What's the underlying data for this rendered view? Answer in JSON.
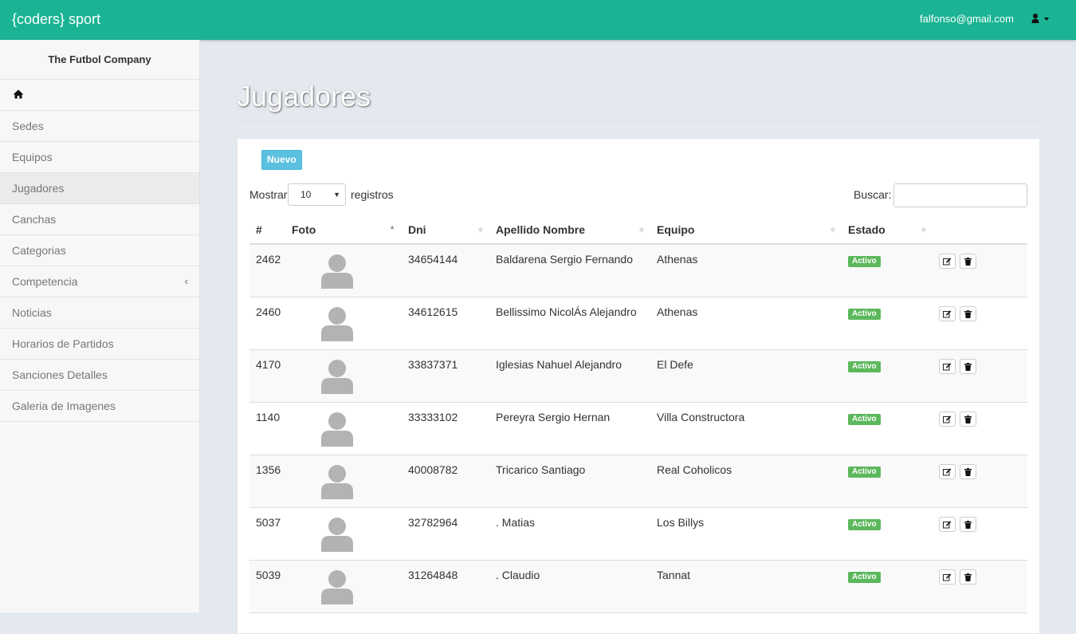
{
  "header": {
    "brand": "{coders} sport",
    "user_email": "falfonso@gmail.com",
    "user_icon": "user-icon"
  },
  "sidebar": {
    "company": "The Futbol Company",
    "items": [
      {
        "label": "",
        "icon": "home-icon"
      },
      {
        "label": "Sedes"
      },
      {
        "label": "Equipos"
      },
      {
        "label": "Jugadores"
      },
      {
        "label": "Canchas"
      },
      {
        "label": "Categorias"
      },
      {
        "label": "Competencia",
        "icon": "chevron-left-icon"
      },
      {
        "label": "Noticias"
      },
      {
        "label": "Horarios de Partidos"
      },
      {
        "label": "Sanciones Detalles"
      },
      {
        "label": "Galeria de Imagenes"
      }
    ]
  },
  "main": {
    "title": "Jugadores",
    "new_button": "Nuevo",
    "length": {
      "prefix": "Mostrar",
      "value": "10",
      "suffix": "registros"
    },
    "search": {
      "label": "Buscar:",
      "value": ""
    },
    "columns": [
      "#",
      "Foto",
      "Dni",
      "Apellido Nombre",
      "Equipo",
      "Estado",
      ""
    ],
    "rows": [
      {
        "id": "2462",
        "dni": "34654144",
        "name": "Baldarena Sergio Fernando",
        "team": "Athenas",
        "status": "Activo"
      },
      {
        "id": "2460",
        "dni": "34612615",
        "name": "Bellissimo NicolÁs Alejandro",
        "team": "Athenas",
        "status": "Activo"
      },
      {
        "id": "4170",
        "dni": "33837371",
        "name": "Iglesias Nahuel Alejandro",
        "team": "El Defe",
        "status": "Activo"
      },
      {
        "id": "1140",
        "dni": "33333102",
        "name": "Pereyra Sergio Hernan",
        "team": "Villa Constructora",
        "status": "Activo"
      },
      {
        "id": "1356",
        "dni": "40008782",
        "name": "Tricarico Santiago",
        "team": "Real Coholicos",
        "status": "Activo"
      },
      {
        "id": "5037",
        "dni": "32782964",
        "name": ". Matias",
        "team": "Los Billys",
        "status": "Activo"
      },
      {
        "id": "5039",
        "dni": "31264848",
        "name": ". Claudio",
        "team": "Tannat",
        "status": "Activo"
      }
    ]
  },
  "colors": {
    "topbar": "#1ab394",
    "badge": "#5cb85c",
    "new_button": "#5bc0de",
    "background": "#e4e8ef"
  }
}
